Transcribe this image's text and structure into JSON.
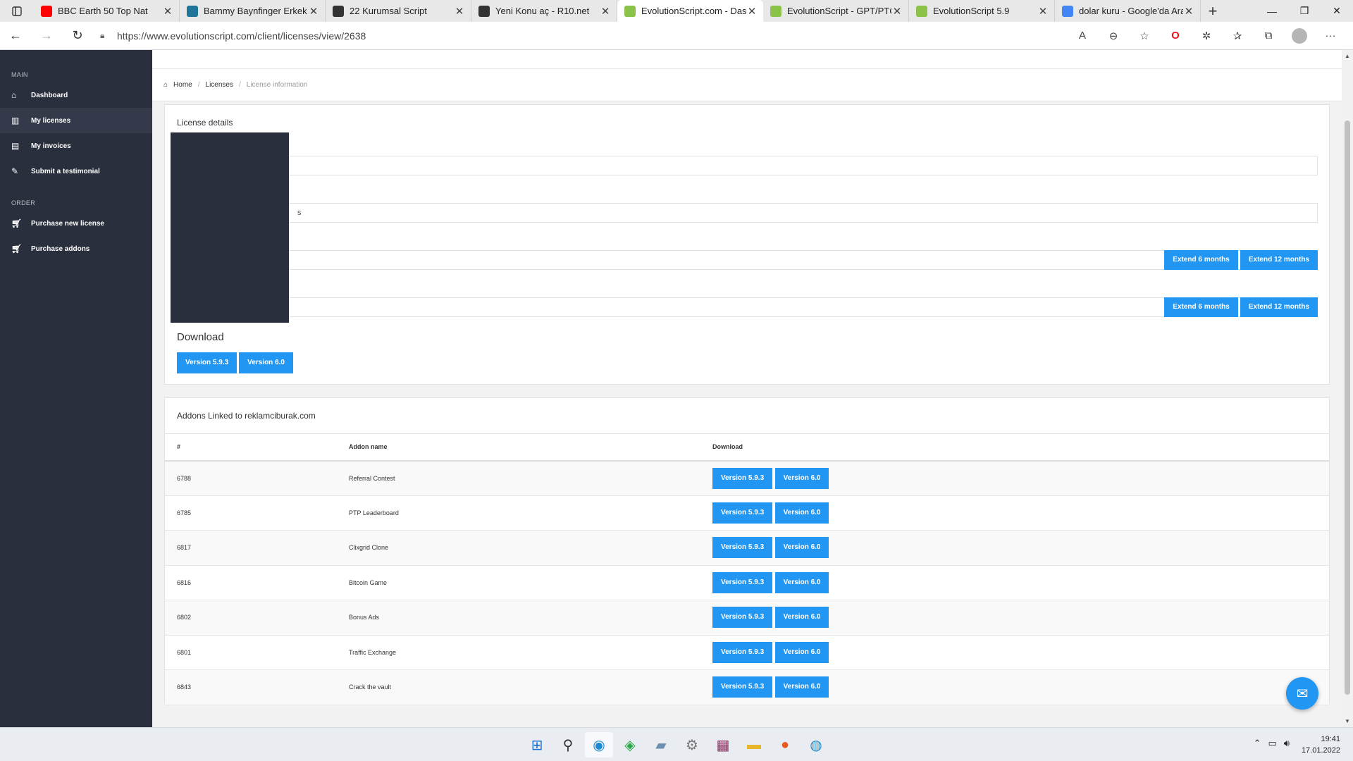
{
  "browser": {
    "tabs": [
      {
        "title": "BBC Earth 50 Top Nat",
        "icon": "youtube-icon",
        "icon_color": "#ff0000"
      },
      {
        "title": "Bammy Baynfinger Erkek K",
        "icon": "wordpress-icon",
        "icon_color": "#21759b"
      },
      {
        "title": "22 Kurumsal Script",
        "icon": "forum-icon",
        "icon_color": "#333333"
      },
      {
        "title": "Yeni Konu aç - R10.net",
        "icon": "forum-icon",
        "icon_color": "#333333"
      },
      {
        "title": "EvolutionScript.com - Dash",
        "icon": "evolution-icon",
        "icon_color": "#8bc34a",
        "active": true
      },
      {
        "title": "EvolutionScript - GPT/PTC",
        "icon": "evolution-icon",
        "icon_color": "#8bc34a"
      },
      {
        "title": "EvolutionScript 5.9",
        "icon": "evolution-icon",
        "icon_color": "#8bc34a"
      },
      {
        "title": "dolar kuru - Google'da Ara",
        "icon": "google-icon",
        "icon_color": "#4285f4"
      }
    ],
    "url": "https://www.evolutionscript.com/client/licenses/view/2638"
  },
  "sidebar": {
    "sections": [
      {
        "label": "MAIN",
        "items": [
          {
            "label": "Dashboard",
            "icon": "home-icon"
          },
          {
            "label": "My licenses",
            "icon": "licenses-icon",
            "active": true
          },
          {
            "label": "My invoices",
            "icon": "invoice-icon"
          },
          {
            "label": "Submit a testimonial",
            "icon": "edit-icon"
          }
        ]
      },
      {
        "label": "ORDER",
        "items": [
          {
            "label": "Purchase new license",
            "icon": "cart-icon"
          },
          {
            "label": "Purchase addons",
            "icon": "cart-icon"
          }
        ]
      }
    ]
  },
  "breadcrumb": {
    "home": "Home",
    "licenses": "Licenses",
    "current": "License information"
  },
  "license": {
    "title": "License details",
    "field2_value": "s",
    "extend6": "Extend 6 months",
    "extend12": "Extend 12 months"
  },
  "download": {
    "title": "Download",
    "v1": "Version 5.9.3",
    "v2": "Version 6.0"
  },
  "addons": {
    "title": "Addons Linked to reklamciburak.com",
    "columns": [
      "#",
      "Addon name",
      "Download"
    ],
    "rows": [
      {
        "id": "6788",
        "name": "Referral Contest"
      },
      {
        "id": "6785",
        "name": "PTP Leaderboard"
      },
      {
        "id": "6817",
        "name": "Clixgrid Clone"
      },
      {
        "id": "6816",
        "name": "Bitcoin Game"
      },
      {
        "id": "6802",
        "name": "Bonus Ads"
      },
      {
        "id": "6801",
        "name": "Traffic Exchange"
      },
      {
        "id": "6843",
        "name": "Crack the vault"
      }
    ],
    "v1": "Version 5.9.3",
    "v2": "Version 6.0"
  },
  "taskbar": {
    "time": "19:41",
    "date": "17.01.2022"
  },
  "colors": {
    "sidebar": "#2a2f3d",
    "primary": "#2196f3"
  }
}
